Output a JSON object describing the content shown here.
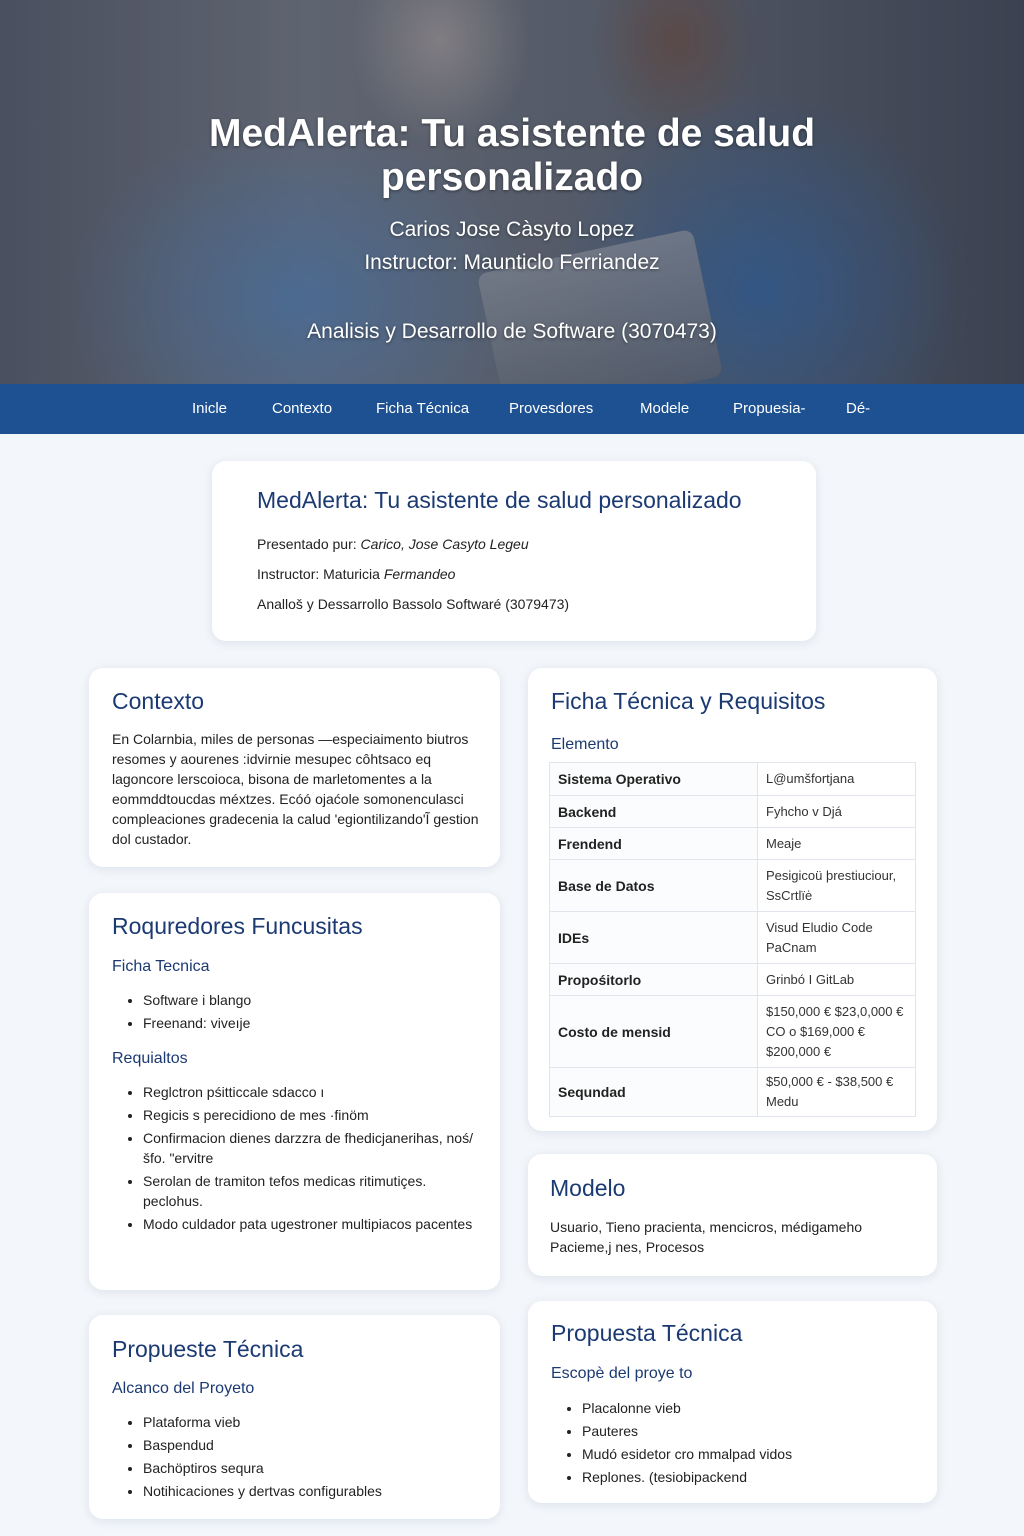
{
  "hero": {
    "title": "MedAlerta: Tu asistente de salud personalizado",
    "author": "Carios Jose Càsyto Lopez",
    "instructor": "Instructor: Maunticlo Ferriandez",
    "program": "Analisis y Desarrollo de Software (3070473)"
  },
  "nav": [
    "Inicle",
    "Contexto",
    "Ficha Técnica",
    "Provesdores",
    "Modele",
    "Propuesia-",
    "Dé-"
  ],
  "intro": {
    "title": "MedAlerta: Tu asistente de salud personalizado",
    "presented_label": "Presentado pur: ",
    "presented_name": "Carico, Jose Casyto Legeu",
    "instructor_label": "Instructor: Maturicia ",
    "instructor_name": "Fermandeo",
    "program": "Analloš y Dessarrollo Bassolo Softwaré (3079473)"
  },
  "contexto": {
    "title": "Contexto",
    "text": "En Colarnbia, miles de personas —especiaimento biutros resomes y aourenes :idvirnie mesupec côhtsaco eq lagoncore lerscoioca, bisona de marletomentes a la eommddtoucdas méxtzes. Ecóó ojaćole somonenculasci compleaciones gradecenia la calud 'egiontilizando'Ĩ gestion dol custador."
  },
  "requisitos_card": {
    "title": "Roquredores Funcusitas",
    "sub1": "Ficha Tecnica",
    "list1": [
      "Software i blango",
      "Freenand: viveıje"
    ],
    "sub2": "Requialtos",
    "list2": [
      "Reglctron pśitticcale sdacco ı",
      "Regicis s perecidiono de mes ·finöm",
      "Confirmacion dienes darzzra de fhedicjanerihas, noś/šfo. \"ervitre",
      "Serolan de tramiton tefos medicas ritimutiçes. peclohus.",
      "Modo culdador pata ugestroner multipiacos pacentes"
    ]
  },
  "propuesta_left": {
    "title": "Propueste Técnica",
    "sub": "Alcanco del Proyeto",
    "list": [
      "Plataforma vieb",
      "Baspendud",
      "Bachöptiros sequra",
      "Notihicaciones y dertvas configurables"
    ]
  },
  "ficha": {
    "title": "Ficha Técnica y Requisitos",
    "sub": "Elemento",
    "rows": [
      {
        "k": "Sistema Operativo",
        "v": "L@umšfortjana"
      },
      {
        "k": "Backend",
        "v": "Fyhcho v Djá"
      },
      {
        "k": "Frendend",
        "v": "Meaje"
      },
      {
        "k": "Base de Datos",
        "v": "Pesigicoü þrestiuciour, SsCrtlïė"
      },
      {
        "k": "IDEs",
        "v": "Visud Eludio Code PaCnam"
      },
      {
        "k": "Propośitorlo",
        "v": "Grinbó I GitLab"
      },
      {
        "k": "Costo de mensid",
        "v": "$150,000 € $23,0,000 € CO o $169,000 €  $200,000 €"
      },
      {
        "k": "Sequndad",
        "v": "$50,000 € - $38,500 € Medu"
      }
    ]
  },
  "modelo": {
    "title": "Modelo",
    "text": "Usuario, Tieno pracienta, mencicros, médigameho Pacieme,j nes, Procesos"
  },
  "propuesta_right": {
    "title": "Propuesta Técnica",
    "sub": "Escopè del proye to",
    "list": [
      "Placalonne vieb",
      "Pauteres",
      "Mudó esidetor cro mmalpad vidos",
      "Replones. (tesiobipackend"
    ]
  }
}
